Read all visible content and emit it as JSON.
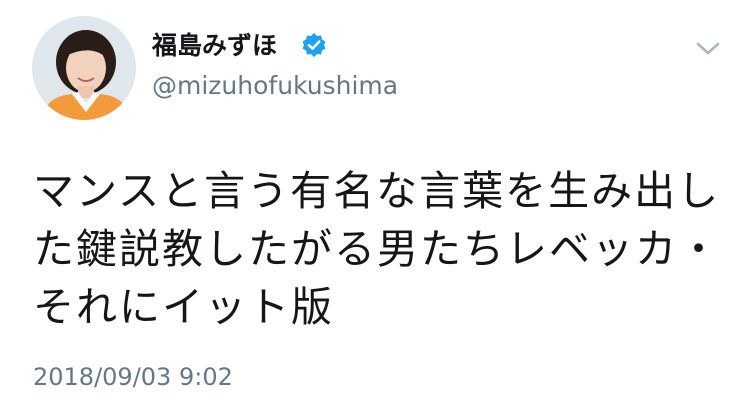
{
  "tweet": {
    "author": {
      "display_name": "福島みずほ",
      "handle": "@mizuhofukushima",
      "verified": true
    },
    "text": "マンスと言う有名な言葉を生み出した鍵説教したがる男たちレベッカ・それにイット版",
    "timestamp": "2018/09/03 9:02"
  },
  "icons": {
    "verified": "verified-badge-icon",
    "menu": "chevron-down-icon",
    "avatar": "profile-photo"
  },
  "colors": {
    "verified_blue": "#1da1f2",
    "text_primary": "#14171a",
    "text_secondary": "#657786",
    "caret_gray": "#aab8c2"
  }
}
